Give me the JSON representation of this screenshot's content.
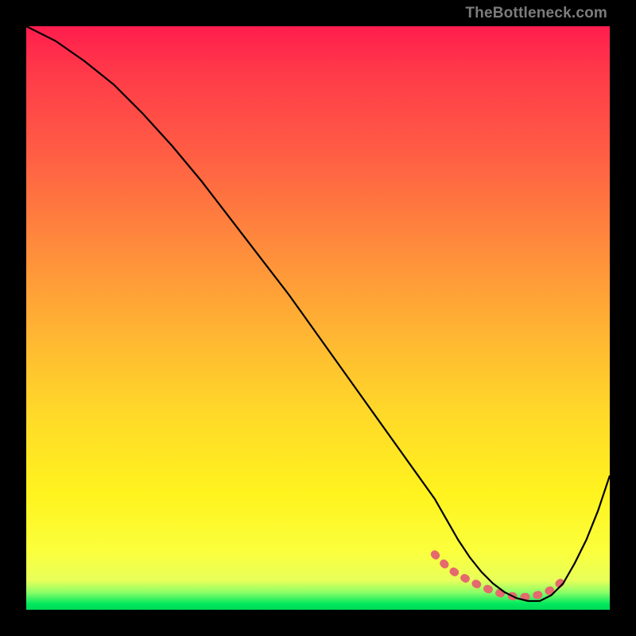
{
  "watermark": "TheBottleneck.com",
  "chart_data": {
    "type": "line",
    "title": "",
    "xlabel": "",
    "ylabel": "",
    "xlim": [
      0,
      100
    ],
    "ylim": [
      0,
      100
    ],
    "grid": false,
    "series": [
      {
        "name": "bottleneck-curve",
        "x": [
          0,
          5,
          10,
          15,
          20,
          25,
          30,
          35,
          40,
          45,
          50,
          55,
          60,
          65,
          70,
          72,
          74,
          76,
          78,
          80,
          82,
          84,
          86,
          88,
          90,
          92,
          94,
          96,
          98,
          100
        ],
        "y": [
          100,
          97.5,
          94,
          90,
          85,
          79.5,
          73.5,
          67,
          60.5,
          54,
          47,
          40,
          33,
          26,
          19,
          15.5,
          12,
          9,
          6.5,
          4.5,
          3,
          2,
          1.5,
          1.5,
          2.5,
          4.5,
          8,
          12,
          17,
          23
        ]
      },
      {
        "name": "optimal-region-dots",
        "x": [
          70,
          72,
          74,
          76,
          78,
          80,
          82,
          84,
          86,
          88,
          90,
          92
        ],
        "y": [
          9.5,
          7.5,
          6,
          5,
          4,
          3.2,
          2.6,
          2.2,
          2.2,
          2.6,
          3.4,
          5
        ]
      }
    ],
    "background_gradient": {
      "top": "#ff1d4e",
      "mid_upper": "#ff8c3c",
      "mid_lower": "#fff31e",
      "bottom": "#00d856"
    }
  }
}
